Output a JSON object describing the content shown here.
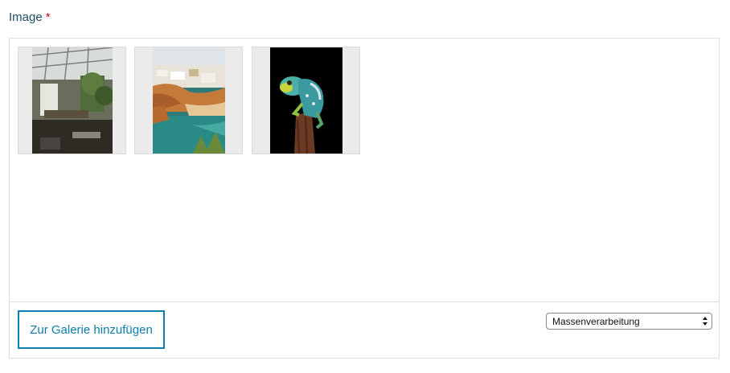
{
  "field": {
    "label": "Image",
    "required_marker": "*"
  },
  "gallery": {
    "images": [
      {
        "name": "greenhouse-interior-photo",
        "description_icon": "image-thumbnail"
      },
      {
        "name": "coastal-town-beach-photo",
        "description_icon": "image-thumbnail"
      },
      {
        "name": "lizard-on-branch-photo",
        "description_icon": "image-thumbnail"
      }
    ]
  },
  "footer": {
    "add_button_label": "Zur Galerie hinzufügen",
    "bulk_select_value": "Massenverarbeitung"
  },
  "colors": {
    "accent": "#0d7db0",
    "label": "#1b4d63",
    "required": "#d0021b",
    "border": "#dedede"
  }
}
